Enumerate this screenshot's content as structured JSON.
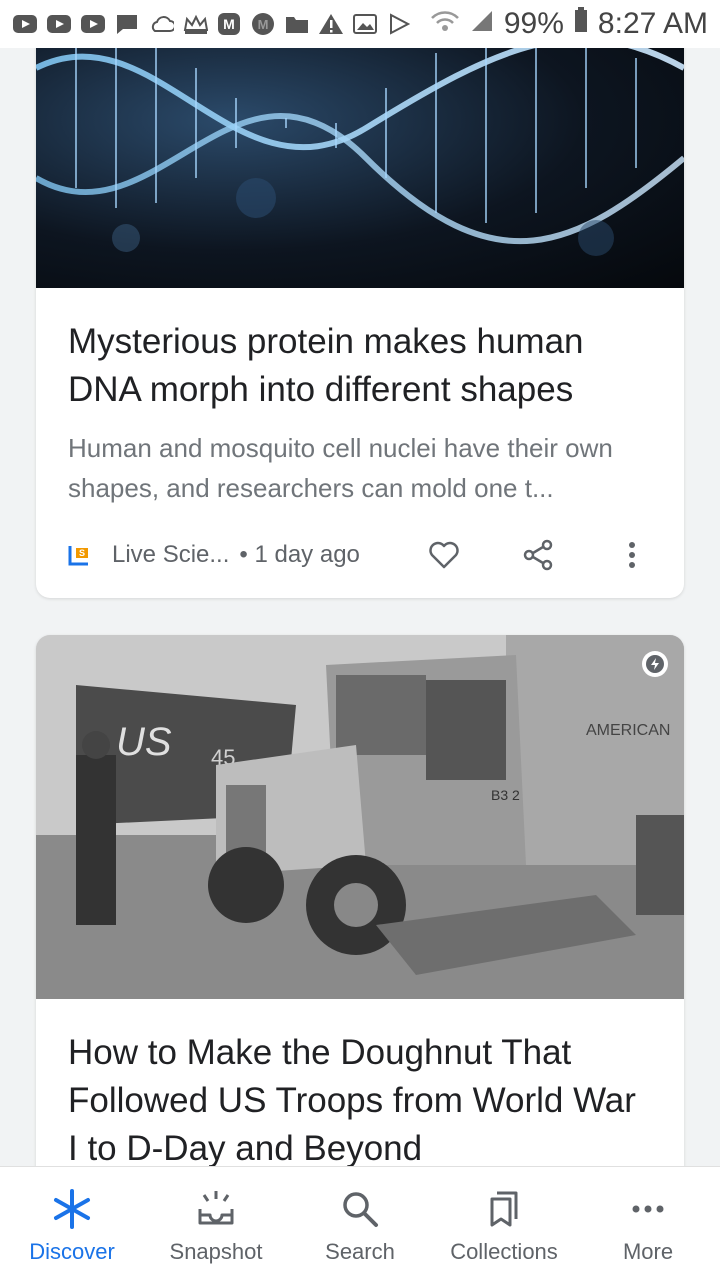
{
  "status_bar": {
    "battery": "99%",
    "time": "8:27 AM"
  },
  "cards": [
    {
      "title": "Mysterious protein makes human DNA morph into different shapes",
      "snippet": "Human and mosquito cell nuclei have their own shapes, and researchers can mold one t...",
      "source": "Live Scie...",
      "age": "• 1 day ago"
    },
    {
      "title": "How to Make the Doughnut That Followed US Troops from World War I to D-Day and Beyond",
      "hero_text": {
        "hull": "US",
        "hull_number": "45",
        "truck_side": "AMERICAN",
        "truck_number": "B3 2"
      }
    }
  ],
  "bottom_nav": {
    "discover": "Discover",
    "snapshot": "Snapshot",
    "search": "Search",
    "collections": "Collections",
    "more": "More"
  },
  "colors": {
    "accent": "#1a73e8",
    "text_primary": "#202124",
    "text_secondary": "#70757a"
  }
}
